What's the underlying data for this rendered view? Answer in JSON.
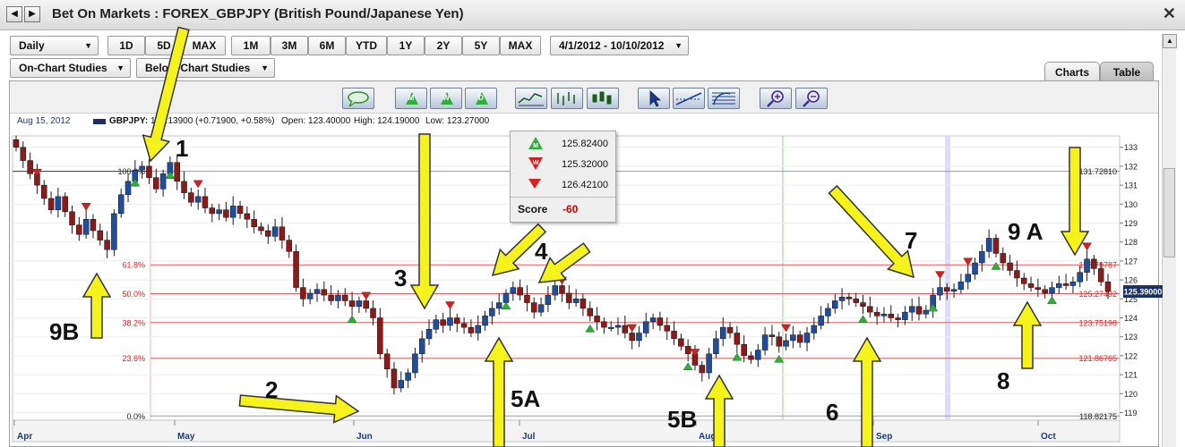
{
  "window": {
    "title": "Bet On Markets : FOREX_GBPJPY (British Pound/Japanese Yen)",
    "back_glyph": "◀",
    "forward_glyph": "▶",
    "close_glyph": "✕"
  },
  "toolbar": {
    "interval": "Daily",
    "ranges": [
      "1D",
      "5D",
      "MAX",
      "1M",
      "3M",
      "6M",
      "YTD",
      "1Y",
      "2Y",
      "5Y",
      "MAX"
    ],
    "date_range": "4/1/2012 - 10/10/2012",
    "on_chart_studies": "On-Chart Studies",
    "below_chart_studies": "Below-Chart Studies",
    "caret": "▼"
  },
  "tabs": {
    "charts": "Charts",
    "table": "Table"
  },
  "chart_tools": {
    "m_letter": "M",
    "w_letter": "W",
    "d_letter": "D"
  },
  "chart_info": {
    "date": "Aug 15, 2012",
    "symbol": "GBPJPY:",
    "last": "123.13900 (+0.71900, +0.58%)",
    "open": "Open: 123.40000",
    "high": "High: 124.19000",
    "low": "Low: 123.27000"
  },
  "signal_legend": {
    "m_value": "125.82400",
    "w_value": "125.32000",
    "down_value": "126.42100",
    "score_label": "Score",
    "score_value": "-60",
    "colors": {
      "m": "#2fae3a",
      "w": "#d42020",
      "down": "#d42020"
    }
  },
  "chart_data": {
    "type": "candlestick",
    "y_axis_ticks": [
      133,
      132,
      131,
      130,
      129,
      128,
      127,
      126,
      125,
      124,
      123,
      122,
      121,
      120,
      119
    ],
    "ylim": [
      118.6,
      133.6
    ],
    "x_axis_labels": [
      "Apr",
      "May",
      "Jun",
      "Jul",
      "Aug",
      "Sep",
      "Oct"
    ],
    "current_price": "125.39000",
    "fib_levels": [
      {
        "pct": "100.0%",
        "price": "131.72810",
        "value": 131.7281
      },
      {
        "pct": "61.8%",
        "price": "126.79787",
        "value": 126.79787
      },
      {
        "pct": "50.0%",
        "price": "125.27492",
        "value": 125.27492
      },
      {
        "pct": "38.2%",
        "price": "123.75198",
        "value": 123.75198
      },
      {
        "pct": "23.6%",
        "price": "121.86765",
        "value": 121.86765
      },
      {
        "pct": "0.0%",
        "price": "118.82175",
        "value": 118.82175
      }
    ],
    "close_series": [
      133.0,
      132.3,
      131.6,
      131.0,
      130.3,
      129.7,
      130.4,
      129.6,
      128.9,
      128.4,
      129.2,
      128.6,
      128.1,
      127.6,
      129.5,
      130.5,
      131.2,
      131.8,
      132.0,
      131.4,
      130.8,
      131.6,
      132.2,
      131.2,
      130.6,
      130.1,
      130.4,
      129.8,
      129.5,
      129.7,
      129.3,
      129.9,
      129.5,
      129.2,
      128.8,
      128.6,
      128.3,
      128.8,
      128.1,
      127.5,
      125.6,
      125.0,
      125.3,
      125.5,
      125.2,
      124.9,
      125.2,
      124.9,
      124.6,
      124.9,
      124.5,
      124.0,
      122.1,
      121.3,
      120.3,
      120.7,
      121.1,
      122.1,
      122.9,
      123.4,
      123.9,
      123.6,
      124.0,
      123.7,
      123.5,
      123.2,
      123.6,
      124.1,
      124.5,
      124.8,
      125.3,
      125.6,
      125.2,
      124.8,
      124.3,
      124.7,
      125.2,
      125.7,
      125.3,
      124.8,
      125.0,
      124.5,
      124.1,
      123.8,
      123.5,
      123.5,
      123.6,
      123.2,
      122.8,
      123.2,
      123.8,
      124.0,
      123.6,
      123.3,
      122.9,
      122.5,
      122.1,
      121.5,
      121.1,
      122.1,
      122.9,
      123.5,
      123.2,
      122.6,
      122.0,
      121.8,
      122.3,
      123.1,
      123.0,
      122.5,
      122.8,
      123.1,
      122.7,
      123.2,
      123.6,
      124.1,
      124.5,
      124.9,
      125.1,
      125.0,
      124.8,
      124.6,
      124.3,
      124.1,
      124.2,
      124.0,
      123.9,
      124.3,
      124.6,
      124.2,
      124.4,
      125.2,
      125.6,
      125.4,
      125.5,
      125.9,
      126.3,
      126.9,
      127.5,
      128.2,
      127.4,
      126.9,
      126.5,
      126.1,
      125.8,
      125.6,
      125.5,
      125.3,
      125.6,
      125.8,
      125.7,
      125.9,
      126.4,
      127.1,
      126.6,
      125.9,
      125.4
    ]
  },
  "annotations": {
    "labels": [
      "1",
      "2",
      "3",
      "4",
      "5A",
      "5B",
      "6",
      "7",
      "8",
      "9 A",
      "9B"
    ]
  }
}
